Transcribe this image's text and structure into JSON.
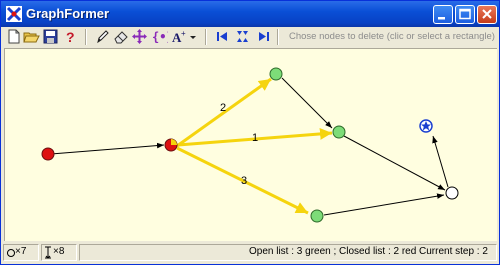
{
  "window": {
    "title": "GraphFormer"
  },
  "toolbar": {
    "tools": [
      "new-icon",
      "open-icon",
      "save-icon",
      "help-icon",
      "pencil-icon",
      "eraser-icon",
      "move-icon",
      "bracket-icon",
      "text-style-icon",
      "dropdown-icon",
      "step-first-icon",
      "step-icon",
      "step-last-icon"
    ],
    "hint": "Chose nodes to delete (clic or select a rectangle)"
  },
  "graph": {
    "edge_labels": {
      "e1": "2",
      "e2": "1",
      "e3": "3"
    },
    "colors": {
      "red": "#dd1111",
      "green": "#7ddc78",
      "yellow": "#f5d40e",
      "blue": "#1a3fd0",
      "white": "#ffffff"
    }
  },
  "status": {
    "nodes_count": "7",
    "edges_count": "8",
    "lists_text": "Open list : 3 green ; Closed list : 2 red",
    "step_text": "Current step : 2"
  }
}
